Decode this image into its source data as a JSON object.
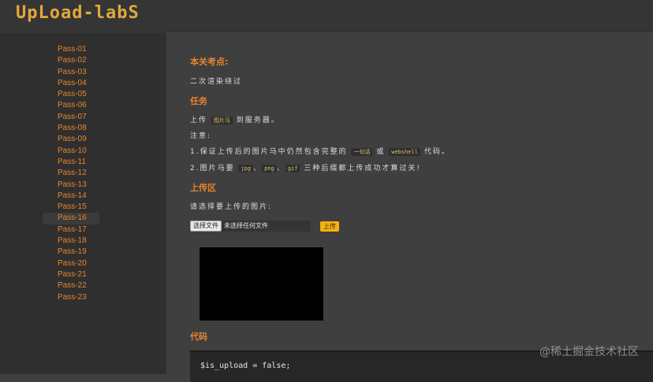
{
  "header": {
    "logo_text": "UpLoad-labS"
  },
  "sidebar": {
    "items": [
      "Pass-01",
      "Pass-02",
      "Pass-03",
      "Pass-04",
      "Pass-05",
      "Pass-06",
      "Pass-07",
      "Pass-08",
      "Pass-09",
      "Pass-10",
      "Pass-11",
      "Pass-12",
      "Pass-13",
      "Pass-14",
      "Pass-15",
      "Pass-16",
      "Pass-17",
      "Pass-18",
      "Pass-19",
      "Pass-20",
      "Pass-21",
      "Pass-22",
      "Pass-23"
    ],
    "active": "Pass-16"
  },
  "main": {
    "section_point": "本关考点:",
    "point_text": "二次渲染绕过",
    "section_task": "任务",
    "task_prefix": "上传",
    "task_chip": "图片马",
    "task_suffix": "到服务器。",
    "note_label": "注意:",
    "note1_prefix": "1.保证上传后的图片马中仍然包含完整的",
    "note1_chip1": "一句话",
    "note1_mid": "或",
    "note1_chip2": "webshell",
    "note1_suffix": "代码。",
    "note2_prefix": "2.图片马要",
    "note2_chip1": "jpg",
    "note2_chip2": "png",
    "note2_chip3": "gif",
    "note2_sep": "、",
    "note2_suffix": "三种后缀都上传成功才算过关!",
    "section_upload": "上传区",
    "upload_prompt": "请选择要上传的图片:",
    "file_button": "选择文件",
    "file_status": "未选择任何文件",
    "upload_button": "上传",
    "section_code": "代码",
    "code_line": "$is_upload = false;"
  },
  "watermark": "@稀土掘金技术社区"
}
